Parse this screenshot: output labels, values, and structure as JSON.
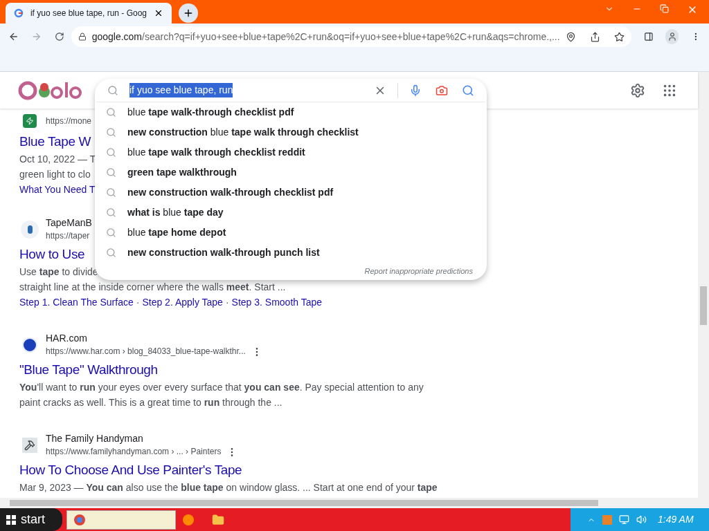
{
  "browser": {
    "tab_title": "if yuo see blue tape, run - Goog",
    "url_host": "google.com",
    "url_path": "/search?q=if+yuo+see+blue+tape%2C+run&oq=if+yuo+see+blue+tape%2C+run&aqs=chrome.,..."
  },
  "search": {
    "query": "if yuo see blue tape, run",
    "query_selected": true,
    "suggestions": [
      {
        "text": "blue **tape walk-through checklist pdf**"
      },
      {
        "text": "**new construction** blue **tape walk through checklist**"
      },
      {
        "text": "blue **tape walk through checklist reddit**"
      },
      {
        "text": "**green tape walkthrough**"
      },
      {
        "text": "**new construction walk-through checklist pdf**"
      },
      {
        "text": "**what is** blue **tape day**"
      },
      {
        "text": "blue **tape home depot**"
      },
      {
        "text": "**new construction walk-through punch list**"
      }
    ],
    "report_link": "Report inappropriate predictions"
  },
  "results": [
    {
      "url": "https://mone",
      "title": "Blue Tape W",
      "snippet": [
        "Oct 10, 2022 — T",
        "green light to clo"
      ],
      "links": [
        "What You Need T"
      ],
      "kind": "bolt"
    },
    {
      "site": "TapeManB",
      "url": "https://taper",
      "title": "How to Use",
      "snippet": [
        "Use **tape** to divide",
        "straight line at the inside corner where the walls **meet**. Start ..."
      ],
      "links": [
        "Step 1. Clean The Surface",
        "Step 2. Apply Tape",
        "Step 3. Smooth Tape"
      ],
      "link_separator": "·",
      "kind": "tape",
      "more_button": false
    },
    {
      "site": "HAR.com",
      "url": "https://www.har.com › blog_84033_blue-tape-walkthr...",
      "title": "\"Blue Tape\" Walkthrough",
      "snippet": [
        "**You**'ll want to **run** your eyes over every surface that **you can see**. Pay special attention to any",
        "paint cracks as well. This is a great time to **run** through the ..."
      ],
      "kind": "har",
      "more_button": true
    },
    {
      "site": "The Family Handyman",
      "url": "https://www.familyhandyman.com › ... › Painters",
      "title": "How To Choose And Use Painter's Tape",
      "snippet": [
        "Mar 9, 2023 — **You can** also use the **blue tape** on window glass. ... Start at one end of your **tape**"
      ],
      "kind": "hammer",
      "more_button": true
    }
  ],
  "taskbar": {
    "start": "start",
    "clock": "1:49 AM"
  }
}
